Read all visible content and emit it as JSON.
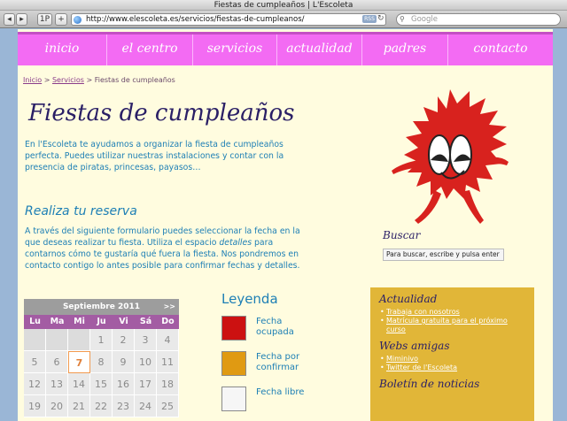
{
  "window": {
    "title": "Fiestas de cumpleaños | L'Escoleta"
  },
  "toolbar": {
    "back": "◂",
    "forward": "▸",
    "share": "1P",
    "add": "+",
    "url": "http://www.elescoleta.es/servicios/fiestas-de-cumpleanos/",
    "rss": "RSS",
    "search_placeholder": "Google"
  },
  "nav": {
    "items": [
      "inicio",
      "el centro",
      "servicios",
      "actualidad",
      "padres",
      "contacto"
    ]
  },
  "breadcrumb": {
    "home": "Inicio",
    "sep1": " > ",
    "services": "Servicios",
    "sep2": " > ",
    "current": "Fiestas de cumpleaños"
  },
  "main": {
    "title": "Fiestas de cumpleaños",
    "intro": "En l'Escoleta te ayudamos a organizar la fiesta de cumpleaños perfecta. Puedes utilizar nuestras instalaciones y contar con la presencia de piratas, princesas, payasos…",
    "reserve_title": "Realiza tu reserva",
    "reserve_text_1": "A través del siguiente formulario puedes seleccionar la fecha en la que deseas realizar tu fiesta. Utiliza el espacio ",
    "reserve_text_em": "detalles",
    "reserve_text_2": " para contarnos cómo te gustaría qué fuera la fiesta. Nos pondremos en contacto contigo lo antes posible para confirmar fechas y detalles."
  },
  "calendar": {
    "month": "Septiembre 2011",
    "next": ">>",
    "weekdays": [
      "Lu",
      "Ma",
      "Mi",
      "Ju",
      "Vi",
      "Sá",
      "Do"
    ],
    "rows": [
      [
        "",
        "",
        "",
        "1",
        "2",
        "3",
        "4"
      ],
      [
        "5",
        "6",
        "7",
        "8",
        "9",
        "10",
        "11"
      ],
      [
        "12",
        "13",
        "14",
        "15",
        "16",
        "17",
        "18"
      ],
      [
        "19",
        "20",
        "21",
        "22",
        "23",
        "24",
        "25"
      ]
    ],
    "today": "7"
  },
  "legend": {
    "title": "Leyenda",
    "items": [
      {
        "label": "Fecha ocupada",
        "color": "#cc1111"
      },
      {
        "label": "Fecha por confirmar",
        "color": "#e09a12"
      },
      {
        "label": "Fecha libre",
        "color": "#f6f6f6"
      }
    ]
  },
  "search": {
    "title": "Buscar",
    "value": "Para buscar, escribe y pulsa enter"
  },
  "sidebar": {
    "news_title": "Actualidad",
    "news_items": [
      "Trabaja con nosotros",
      "Matrícula gratuita para el próximo curso"
    ],
    "friends_title": "Webs amigas",
    "friends_items": [
      "Miminivo",
      "Twitter de l'Escoleta"
    ],
    "newsletter_title": "Boletín de noticias"
  },
  "colors": {
    "nav_bg": "#f36bf3",
    "page_bg": "#fffcdf",
    "text_blue": "#1d7fb5",
    "title_navy": "#2a1f66",
    "sidebar_gold": "#e1b638",
    "mascot_red": "#d8221e"
  }
}
